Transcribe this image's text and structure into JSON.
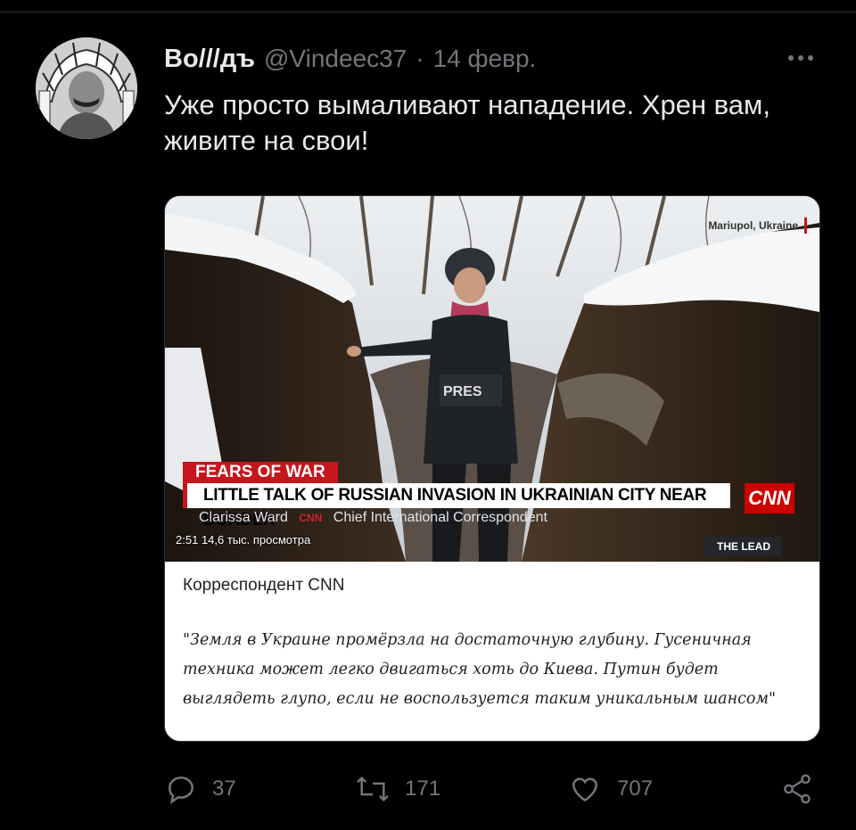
{
  "tweet": {
    "display_name": "Во///дъ",
    "handle": "@Vindeec37",
    "separator": "·",
    "date": "14 февр.",
    "text": "Уже просто вымаливают нападение. Хрен вам, живите на свои!"
  },
  "media": {
    "location": "Mariupol, Ukraine",
    "kicker": "FEARS OF WAR",
    "headline": "LITTLE TALK OF RUSSIAN INVASION IN UKRAINIAN CITY NEAR BORDER",
    "network_logo": "CNN",
    "reporter": "Clarissa Ward",
    "network_small": "CNN",
    "reporter_title": "Chief International Correspondent",
    "overlay_text": "PRES",
    "duration": "2:51",
    "views": "14,6 тыс. просмотра",
    "show": "THE LEAD",
    "caption_title": "Корреспондент CNN",
    "caption_quote": "\"Земля в Украине промёрзла на достаточную глубину. Гусеничная техника может легко двигаться хоть до Киева. Путин будет выглядеть глупо, если не воспользуется таким уникальным шансом\""
  },
  "actions": {
    "replies": "37",
    "retweets": "171",
    "likes": "707"
  },
  "colors": {
    "background": "#000000",
    "text_primary": "#e7e9ea",
    "text_secondary": "#71767b",
    "cnn_red": "#cc0000"
  },
  "icons": [
    "more-icon",
    "reply-icon",
    "retweet-icon",
    "like-icon",
    "share-icon"
  ]
}
